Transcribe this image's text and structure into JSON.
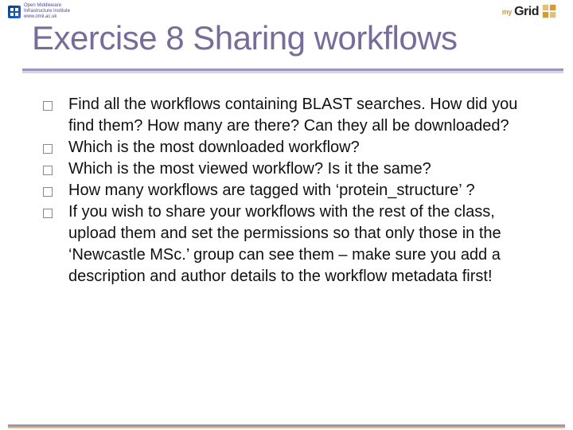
{
  "logos": {
    "left_text_line1": "Open Middleware",
    "left_text_line2": "Infrastructure Institute",
    "left_text_line3": "www.omii.ac.uk",
    "right_my": "my",
    "right_grid": "Grid"
  },
  "title": "Exercise 8 Sharing workflows",
  "page_marker": "",
  "questions": [
    "Find all the workflows containing BLAST searches. How did you find them? How many are there? Can they all be downloaded?",
    "Which is the most downloaded workflow?",
    "Which is the most viewed workflow? Is it the same?",
    "How many workflows are tagged with ‘protein_structure’ ?",
    "If you wish to share your workflows with the rest of the class, upload them and set the permissions so that only those in the ‘Newcastle MSc.’ group can see them – make sure you add a description and author details to the workflow metadata first!"
  ]
}
